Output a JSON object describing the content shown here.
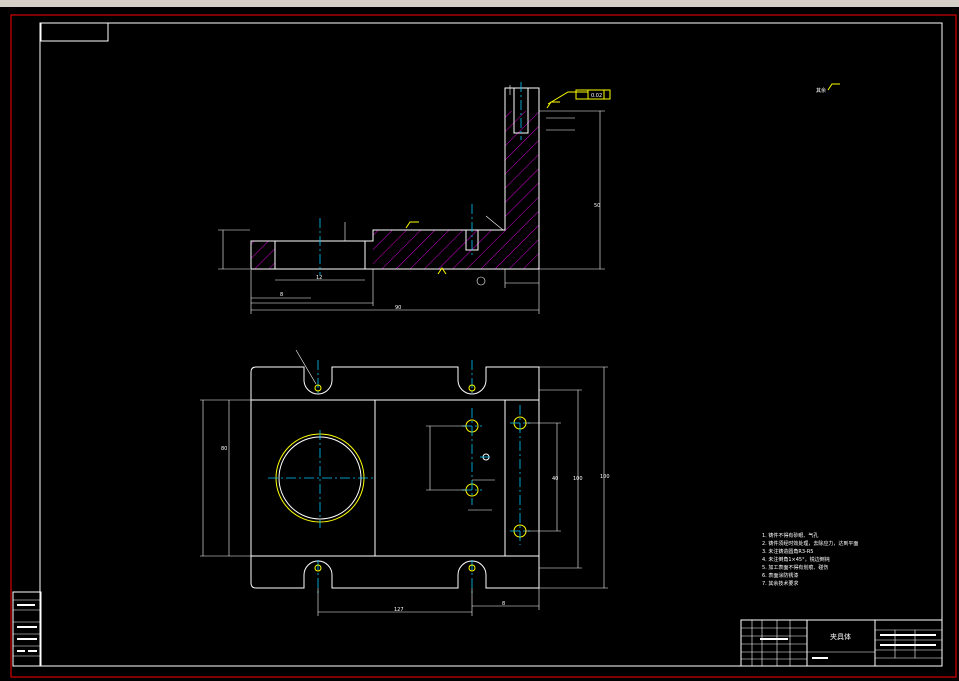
{
  "drawing": {
    "title_text": "夹具体",
    "top_right_note": "其余",
    "dims": {
      "side_total": "90",
      "side_height_right": "50",
      "bore_width": "12",
      "bore_left": "8",
      "plan_left_height": "80",
      "plan_total_height": "100",
      "plan_bottom_left": "127",
      "plan_bottom_right": "8",
      "plan_hole_right_a": "40",
      "plan_hole_right_b": "100"
    },
    "tolerance_frame": "0.02",
    "notes": [
      "1. 铸件不得有砂眼、气孔",
      "2. 铸件须经时效处理，去除应力，达到平面",
      "3. 未注铸造圆角R3-R5",
      "4. 未注倒角1×45°，锐边倒钝",
      "5. 加工表面不得有划痕、碰伤",
      "6. 表面涂防锈漆",
      "7. 其余技术要求"
    ],
    "left_table": [
      "",
      "",
      "",
      ""
    ]
  }
}
